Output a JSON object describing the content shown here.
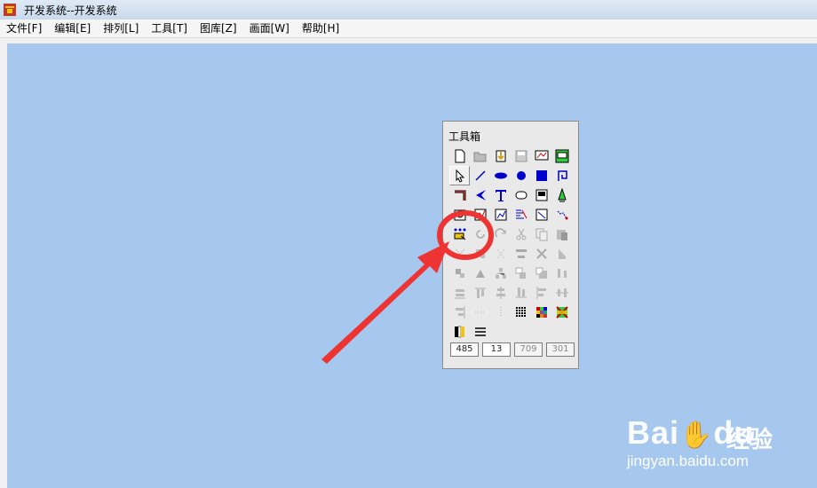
{
  "window": {
    "title": "开发系统--开发系统"
  },
  "menu": [
    "文件[F]",
    "编辑[E]",
    "排列[L]",
    "工具[T]",
    "图库[Z]",
    "画面[W]",
    "帮助[H]"
  ],
  "toolbox": {
    "title": "工具箱",
    "coords": [
      "485",
      "13",
      "709",
      "301"
    ]
  },
  "watermark": {
    "brand": "Bai",
    "brand_suffix": "du",
    "cn": "经验",
    "url": "jingyan.baidu.com"
  },
  "colors": {
    "canvas": "#a6c8ef",
    "annotation": "#ee3333"
  }
}
